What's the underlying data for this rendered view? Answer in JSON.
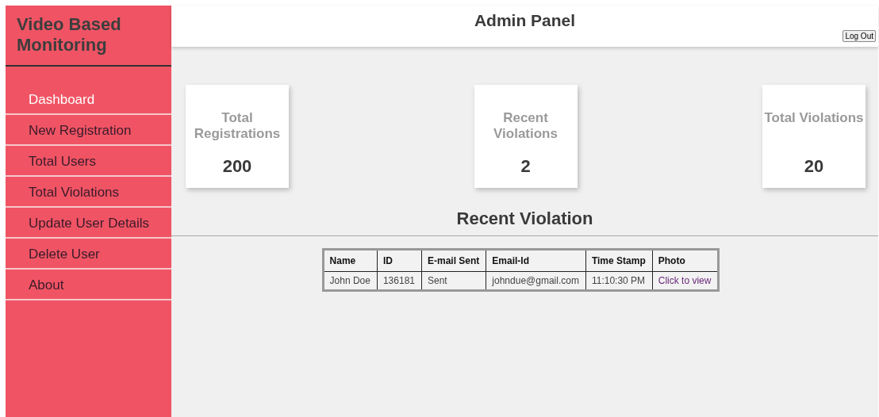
{
  "sidebar": {
    "title": "Video Based Monitoring",
    "items": [
      {
        "label": "Dashboard",
        "selected": true
      },
      {
        "label": "New Registration",
        "selected": false
      },
      {
        "label": "Total Users",
        "selected": false
      },
      {
        "label": "Total Violations",
        "selected": false
      },
      {
        "label": "Update User Details",
        "selected": false
      },
      {
        "label": "Delete User",
        "selected": false
      },
      {
        "label": "About",
        "selected": false
      }
    ]
  },
  "header": {
    "title": "Admin Panel",
    "logout": "Log Out"
  },
  "cards": [
    {
      "label": "Total Registrations",
      "value": "200"
    },
    {
      "label": "Recent Violations",
      "value": "2"
    },
    {
      "label": "Total Violations",
      "value": "20"
    }
  ],
  "section_title": "Recent Violation",
  "table": {
    "columns": [
      "Name",
      "ID",
      "E-mail Sent",
      "Email-Id",
      "Time Stamp",
      "Photo"
    ],
    "rows": [
      {
        "cells": [
          "John Doe",
          "136181",
          "Sent",
          "johndue@gmail.com",
          "11:10:30 PM"
        ],
        "link": "Click to view"
      }
    ]
  }
}
